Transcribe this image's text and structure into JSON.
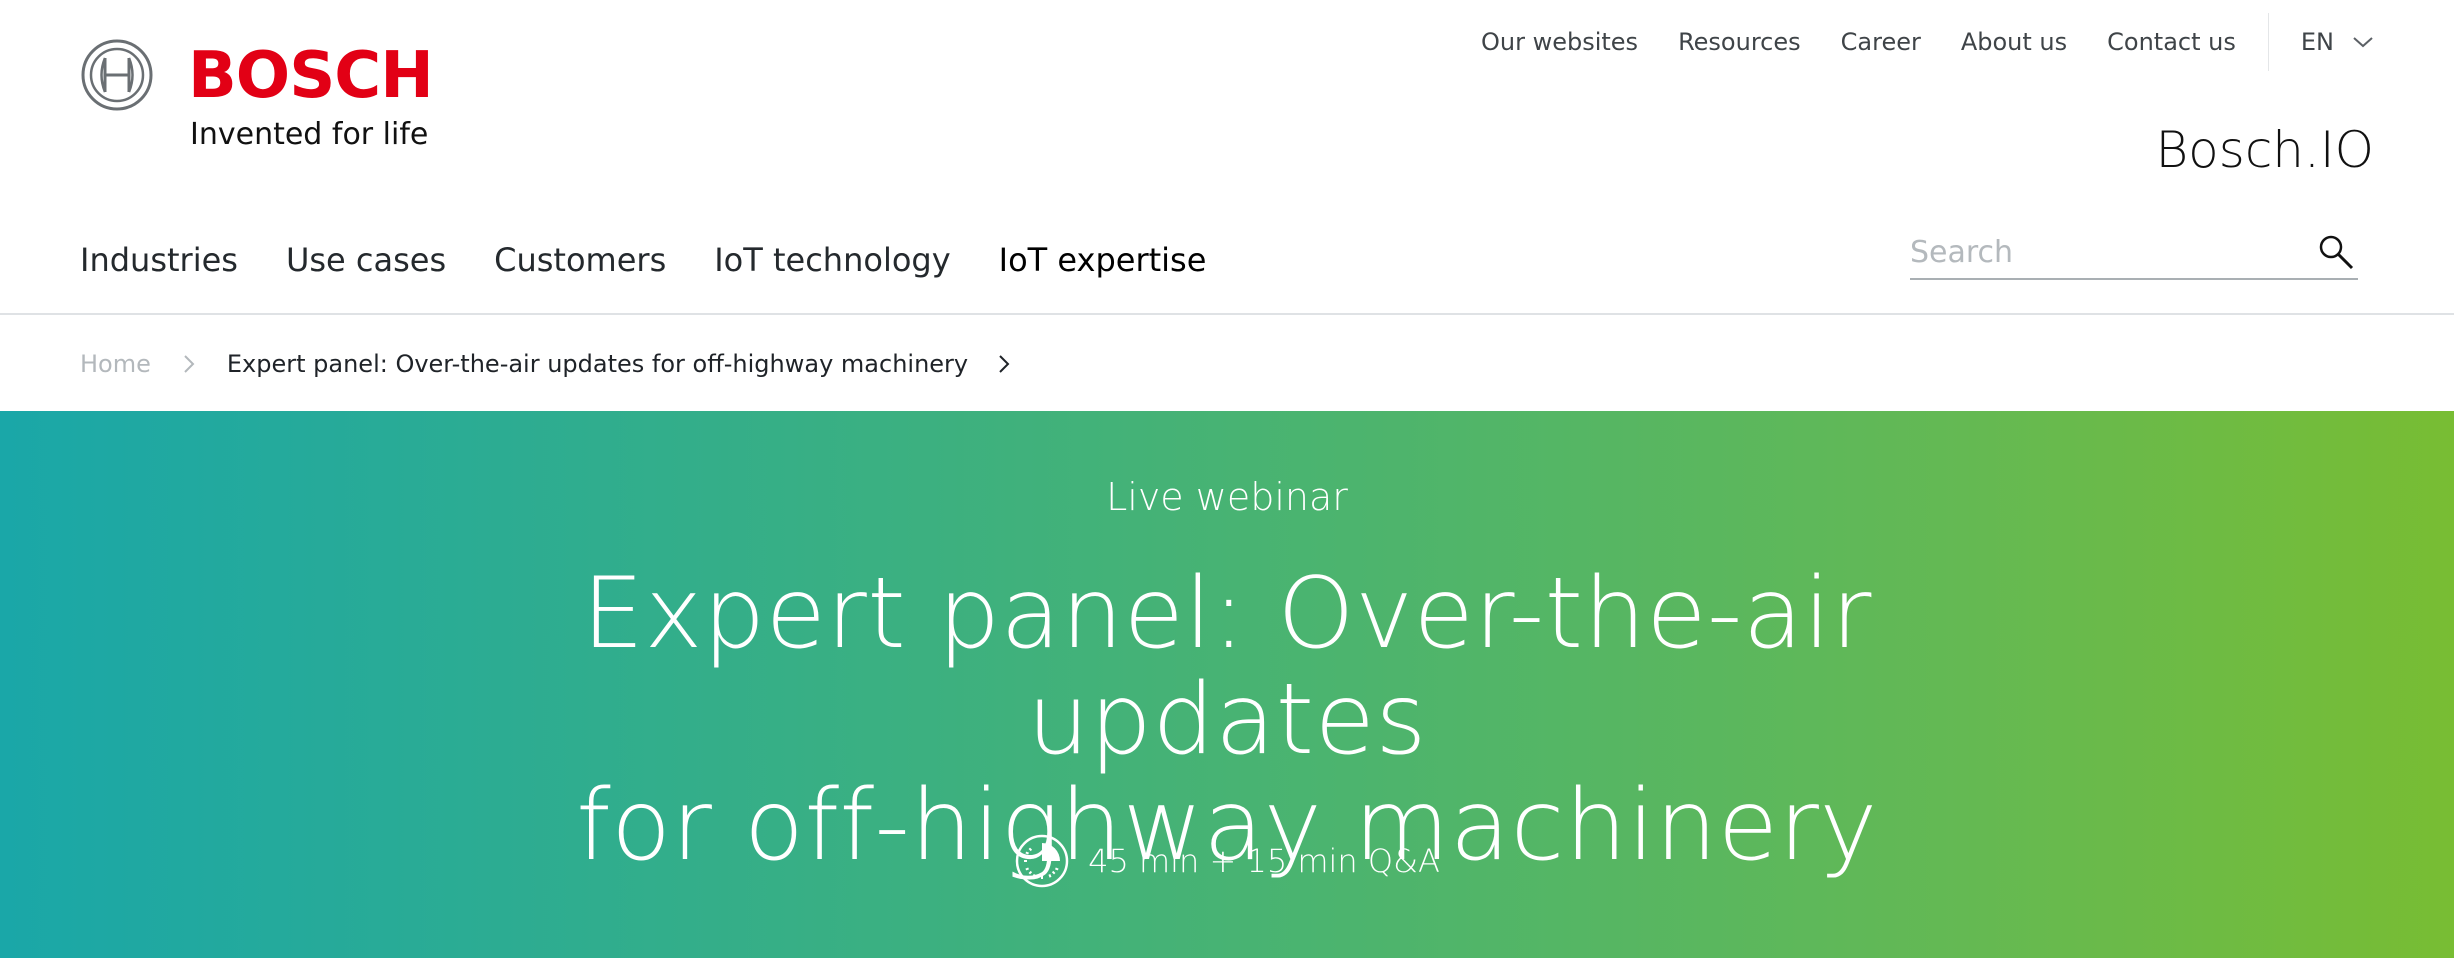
{
  "logo": {
    "wordmark": "BOSCH",
    "tagline": "Invented for life"
  },
  "topnav": {
    "items": [
      "Our websites",
      "Resources",
      "Career",
      "About us",
      "Contact us"
    ],
    "language": "EN"
  },
  "site_name": "Bosch.IO",
  "mainnav": {
    "items": [
      "Industries",
      "Use cases",
      "Customers",
      "IoT technology",
      "IoT expertise"
    ]
  },
  "search": {
    "placeholder": "Search",
    "value": ""
  },
  "breadcrumb": {
    "home": "Home",
    "current": "Expert panel: Over-the-air updates for off-highway machinery"
  },
  "hero": {
    "kicker": "Live webinar",
    "title_line1": "Expert panel: Over-the-air updates",
    "title_line2": "for off-highway machinery",
    "duration": "45 min + 15 min Q&A"
  },
  "colors": {
    "brand_red": "#e20015",
    "hero_gradient_start": "#1aa7a8",
    "hero_gradient_end": "#78bd33"
  },
  "icons": {
    "logo_mark": "bosch-armature-icon",
    "language_dropdown": "chevron-down-icon",
    "search": "search-icon",
    "breadcrumb_separator": "chevron-right-icon",
    "duration": "clock-icon"
  }
}
